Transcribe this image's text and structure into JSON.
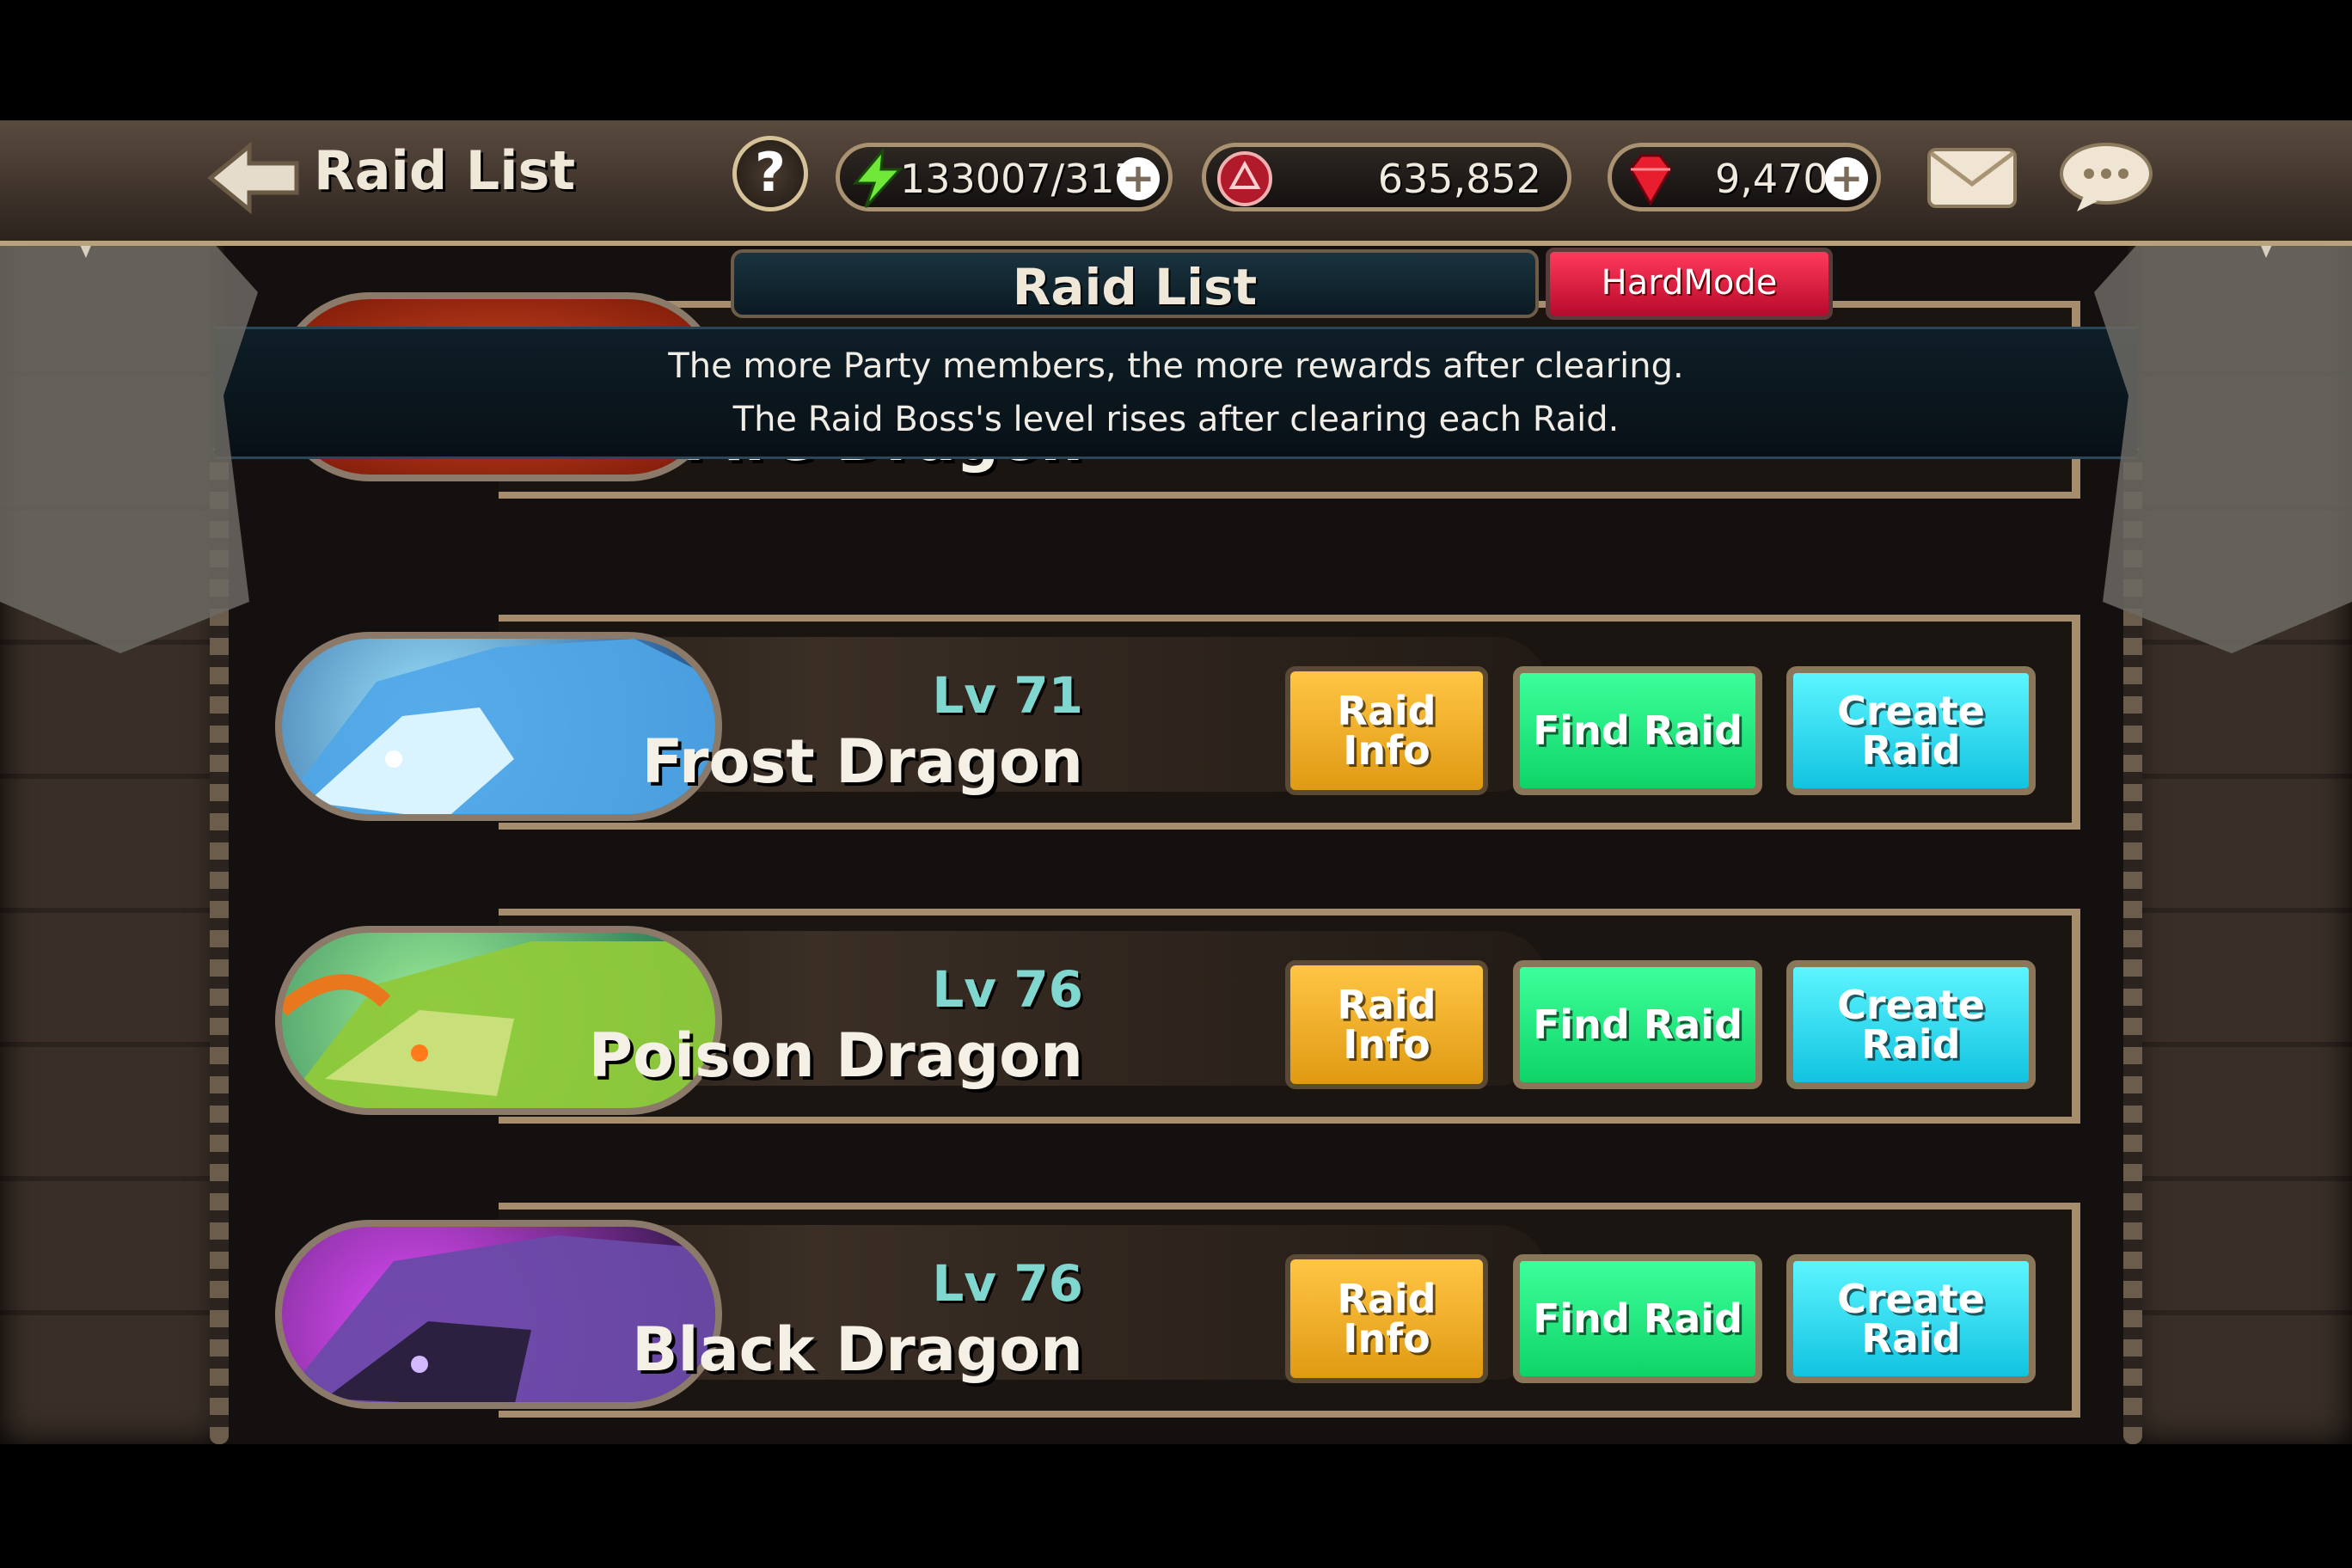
{
  "topbar": {
    "title": "Raid List",
    "help_label": "?",
    "stamina": "133007/317",
    "gold": "635,852",
    "rubies": "9,470",
    "plus": "+"
  },
  "panel": {
    "header": "Raid List",
    "hardmode": "HardMode",
    "info_line1": "The more Party members, the more rewards after clearing.",
    "info_line2": "The Raid Boss's level rises after clearing each Raid."
  },
  "raids": [
    {
      "name": "Fire Dragon",
      "partial": true
    },
    {
      "level": "Lv 71",
      "name": "Frost Dragon",
      "info": "Raid Info",
      "find": "Find Raid",
      "create": "Create Raid",
      "color": "#3a8fe0"
    },
    {
      "level": "Lv 76",
      "name": "Poison Dragon",
      "info": "Raid Info",
      "find": "Find Raid",
      "create": "Create Raid",
      "color": "#7cb52c"
    },
    {
      "level": "Lv 76",
      "name": "Black Dragon",
      "info": "Raid Info",
      "find": "Find Raid",
      "create": "Create Raid",
      "color": "#6a3fb0"
    }
  ],
  "icons": {
    "back": "back-arrow-icon",
    "stamina": "lightning-icon",
    "gold": "crest-coin-icon",
    "rubies": "ruby-gem-icon",
    "mail": "envelope-icon",
    "chat": "speech-bubble-icon"
  }
}
